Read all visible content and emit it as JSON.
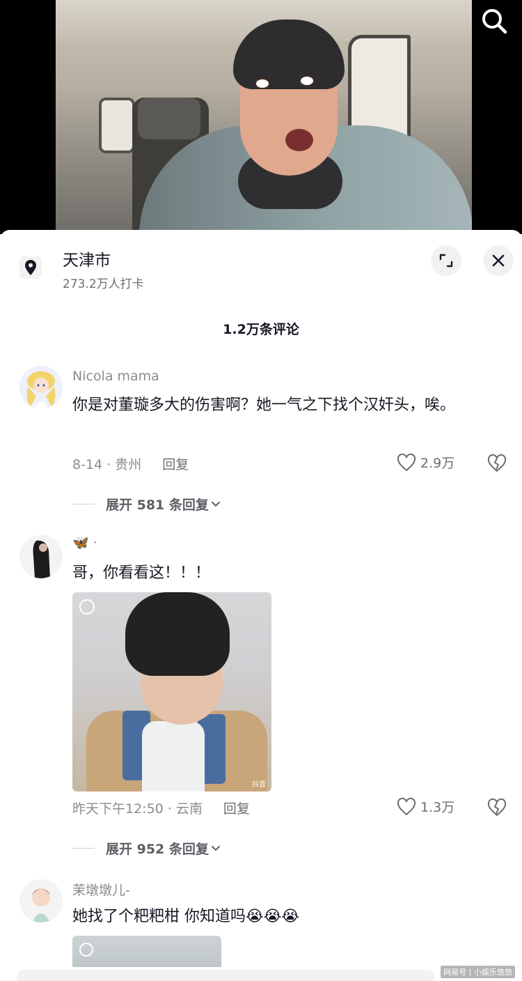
{
  "location": {
    "name": "天津市",
    "checkins": "273.2万人打卡"
  },
  "comments_header": "1.2万条评论",
  "comments": [
    {
      "username": "Nicola  mama",
      "text": "你是对董璇多大的伤害啊？她一气之下找个汉奸头，唉。",
      "meta": "8-14 · 贵州",
      "reply_label": "回复",
      "likes": "2.9万",
      "expand_label": "展开 581 条回复"
    },
    {
      "username": "🦋 ·",
      "text": "哥，你看看这！！！",
      "image_logo": "抖音",
      "meta": "昨天下午12:50 · 云南",
      "reply_label": "回复",
      "likes": "1.3万",
      "expand_label": "展开 952 条回复"
    },
    {
      "username": "茉墩墩儿-",
      "text": "她找了个粑粑柑 你知道吗😭😭😭"
    }
  ],
  "watermark": "网易号 | 小娱乐悠悠",
  "icons": {
    "search": "search-icon",
    "location": "location-pin-icon",
    "expand": "expand-icon",
    "close": "close-icon",
    "like": "heart-icon",
    "dislike": "broken-heart-icon",
    "chevron": "chevron-down-icon"
  }
}
